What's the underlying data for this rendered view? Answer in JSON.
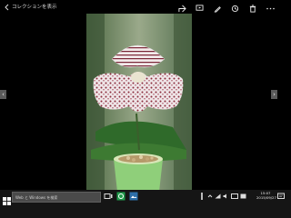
{
  "window": {
    "title": "コレクションを表示",
    "toolbar": {
      "icons": [
        "share-icon",
        "slideshow-icon",
        "edit-icon",
        "rotate-icon",
        "delete-icon",
        "more-icon"
      ]
    }
  },
  "photo": {
    "subject": "",
    "colors": {
      "petal": "#efe5e6",
      "spots": "#8a2a3a",
      "leaves": "#2f6a2a",
      "background": "#6f8a63"
    }
  },
  "taskbar": {
    "search_placeholder": "Web と Windows を検索",
    "clock": {
      "time": "15:07",
      "date": "2015/09/27"
    },
    "tray_icons": [
      "chevron-up-icon",
      "network-icon",
      "volume-icon",
      "keyboard-icon",
      "ime-icon"
    ]
  }
}
